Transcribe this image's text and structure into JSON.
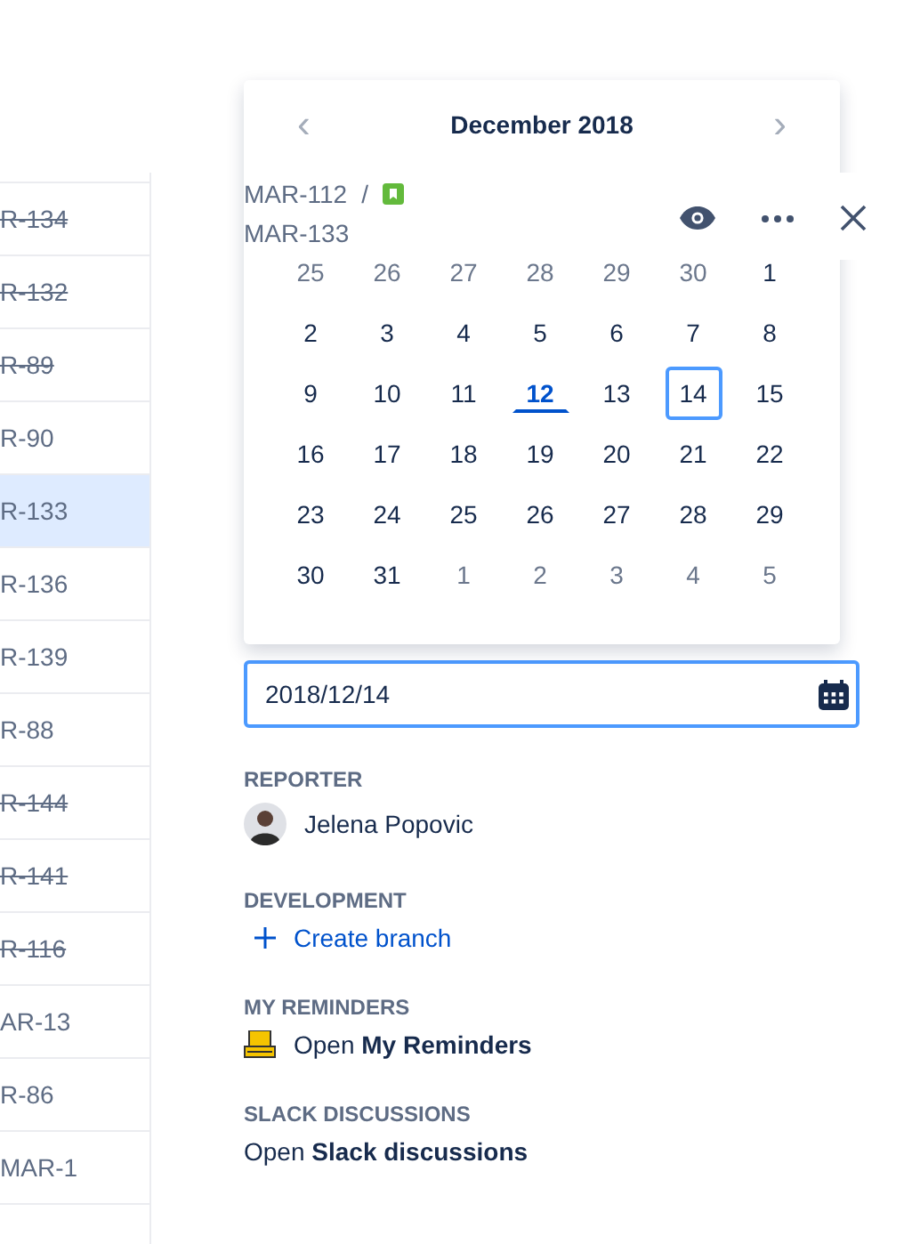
{
  "issue_list": [
    {
      "key": "R-134",
      "done": true,
      "selected": false
    },
    {
      "key": "R-132",
      "done": true,
      "selected": false
    },
    {
      "key": "R-89",
      "done": true,
      "selected": false
    },
    {
      "key": "R-90",
      "done": false,
      "selected": false
    },
    {
      "key": "R-133",
      "done": false,
      "selected": true
    },
    {
      "key": "R-136",
      "done": false,
      "selected": false
    },
    {
      "key": "R-139",
      "done": false,
      "selected": false
    },
    {
      "key": "R-88",
      "done": false,
      "selected": false
    },
    {
      "key": "R-144",
      "done": true,
      "selected": false
    },
    {
      "key": "R-141",
      "done": true,
      "selected": false
    },
    {
      "key": "R-116",
      "done": true,
      "selected": false
    },
    {
      "key": "AR-13",
      "done": false,
      "selected": false
    },
    {
      "key": "R-86",
      "done": false,
      "selected": false
    },
    {
      "key": "MAR-1",
      "done": false,
      "selected": false
    }
  ],
  "issue_header": {
    "parent": "MAR-112",
    "separator": "/",
    "key": "MAR-133"
  },
  "calendar": {
    "title": "December 2018",
    "prev": "‹",
    "next": "›",
    "weeks": [
      [
        {
          "label": "25",
          "muted": true,
          "today": false,
          "selected": false
        },
        {
          "label": "26",
          "muted": true,
          "today": false,
          "selected": false
        },
        {
          "label": "27",
          "muted": true,
          "today": false,
          "selected": false
        },
        {
          "label": "28",
          "muted": true,
          "today": false,
          "selected": false
        },
        {
          "label": "29",
          "muted": true,
          "today": false,
          "selected": false
        },
        {
          "label": "30",
          "muted": true,
          "today": false,
          "selected": false
        },
        {
          "label": "1",
          "muted": false,
          "today": false,
          "selected": false
        }
      ],
      [
        {
          "label": "2",
          "muted": false,
          "today": false,
          "selected": false
        },
        {
          "label": "3",
          "muted": false,
          "today": false,
          "selected": false
        },
        {
          "label": "4",
          "muted": false,
          "today": false,
          "selected": false
        },
        {
          "label": "5",
          "muted": false,
          "today": false,
          "selected": false
        },
        {
          "label": "6",
          "muted": false,
          "today": false,
          "selected": false
        },
        {
          "label": "7",
          "muted": false,
          "today": false,
          "selected": false
        },
        {
          "label": "8",
          "muted": false,
          "today": false,
          "selected": false
        }
      ],
      [
        {
          "label": "9",
          "muted": false,
          "today": false,
          "selected": false
        },
        {
          "label": "10",
          "muted": false,
          "today": false,
          "selected": false
        },
        {
          "label": "11",
          "muted": false,
          "today": false,
          "selected": false
        },
        {
          "label": "12",
          "muted": false,
          "today": true,
          "selected": false
        },
        {
          "label": "13",
          "muted": false,
          "today": false,
          "selected": false
        },
        {
          "label": "14",
          "muted": false,
          "today": false,
          "selected": true
        },
        {
          "label": "15",
          "muted": false,
          "today": false,
          "selected": false
        }
      ],
      [
        {
          "label": "16",
          "muted": false,
          "today": false,
          "selected": false
        },
        {
          "label": "17",
          "muted": false,
          "today": false,
          "selected": false
        },
        {
          "label": "18",
          "muted": false,
          "today": false,
          "selected": false
        },
        {
          "label": "19",
          "muted": false,
          "today": false,
          "selected": false
        },
        {
          "label": "20",
          "muted": false,
          "today": false,
          "selected": false
        },
        {
          "label": "21",
          "muted": false,
          "today": false,
          "selected": false
        },
        {
          "label": "22",
          "muted": false,
          "today": false,
          "selected": false
        }
      ],
      [
        {
          "label": "23",
          "muted": false,
          "today": false,
          "selected": false
        },
        {
          "label": "24",
          "muted": false,
          "today": false,
          "selected": false
        },
        {
          "label": "25",
          "muted": false,
          "today": false,
          "selected": false
        },
        {
          "label": "26",
          "muted": false,
          "today": false,
          "selected": false
        },
        {
          "label": "27",
          "muted": false,
          "today": false,
          "selected": false
        },
        {
          "label": "28",
          "muted": false,
          "today": false,
          "selected": false
        },
        {
          "label": "29",
          "muted": false,
          "today": false,
          "selected": false
        }
      ],
      [
        {
          "label": "30",
          "muted": false,
          "today": false,
          "selected": false
        },
        {
          "label": "31",
          "muted": false,
          "today": false,
          "selected": false
        },
        {
          "label": "1",
          "muted": true,
          "today": false,
          "selected": false
        },
        {
          "label": "2",
          "muted": true,
          "today": false,
          "selected": false
        },
        {
          "label": "3",
          "muted": true,
          "today": false,
          "selected": false
        },
        {
          "label": "4",
          "muted": true,
          "today": false,
          "selected": false
        },
        {
          "label": "5",
          "muted": true,
          "today": false,
          "selected": false
        }
      ]
    ]
  },
  "due_date": {
    "value": "2018/12/14"
  },
  "reporter": {
    "label": "REPORTER",
    "name": "Jelena Popovic"
  },
  "development": {
    "label": "DEVELOPMENT",
    "action": "Create branch"
  },
  "my_reminders": {
    "label": "MY REMINDERS",
    "link": "Open **My Reminders**"
  },
  "slack": {
    "label": "SLACK DISCUSSIONS",
    "link": "Open **Slack discussions**"
  }
}
